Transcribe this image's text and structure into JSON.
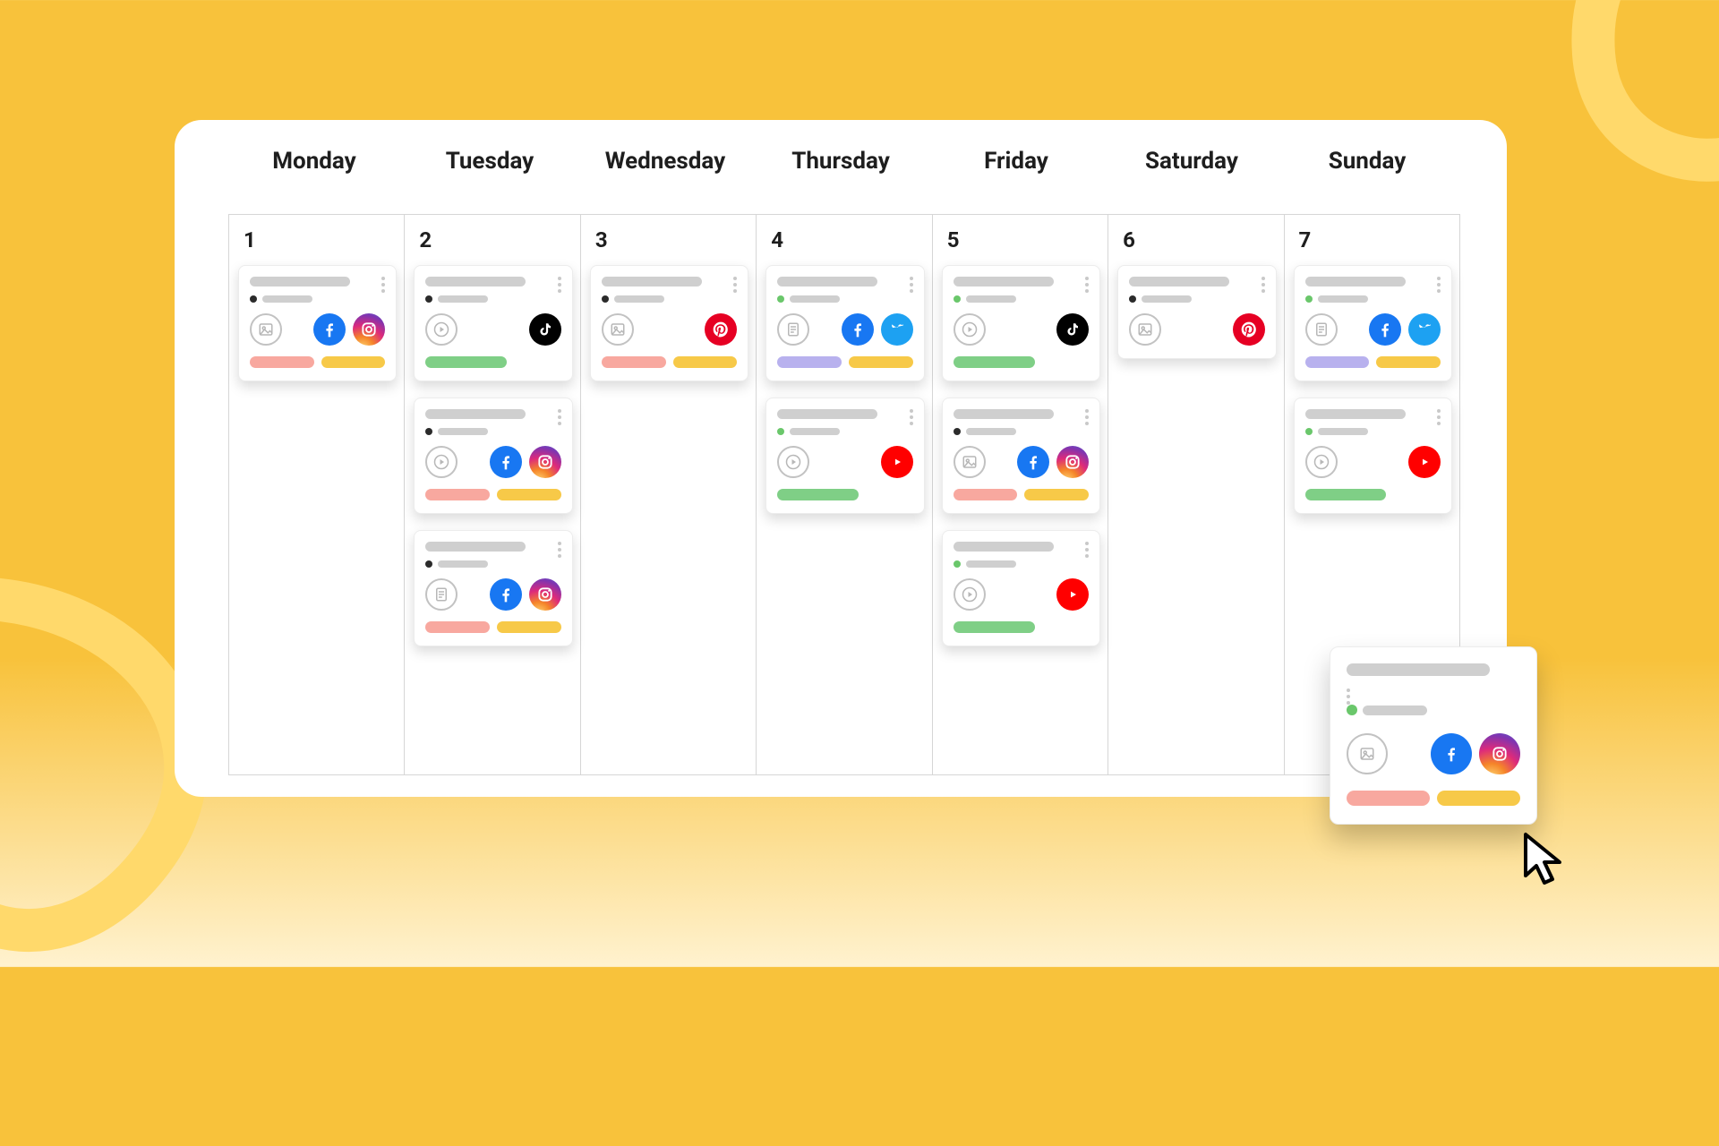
{
  "calendar": {
    "days": [
      {
        "label": "Monday",
        "date": "1",
        "cards": [
          {
            "status": "black",
            "media": "image",
            "socials": [
              "facebook",
              "instagram"
            ],
            "pills": [
              "pink",
              "yellow"
            ]
          }
        ]
      },
      {
        "label": "Tuesday",
        "date": "2",
        "cards": [
          {
            "status": "black",
            "media": "video",
            "socials": [
              "tiktok"
            ],
            "pills": [
              "green"
            ]
          },
          {
            "status": "black",
            "media": "video",
            "socials": [
              "facebook",
              "instagram"
            ],
            "pills": [
              "pink",
              "yellow"
            ]
          },
          {
            "status": "black",
            "media": "doc",
            "socials": [
              "facebook",
              "instagram"
            ],
            "pills": [
              "pink",
              "yellow"
            ]
          }
        ]
      },
      {
        "label": "Wednesday",
        "date": "3",
        "cards": [
          {
            "status": "black",
            "media": "image",
            "socials": [
              "pinterest"
            ],
            "pills": [
              "pink",
              "yellow"
            ]
          }
        ]
      },
      {
        "label": "Thursday",
        "date": "4",
        "cards": [
          {
            "status": "green",
            "media": "doc",
            "socials": [
              "facebook",
              "twitter"
            ],
            "pills": [
              "lilac",
              "yellow"
            ]
          },
          {
            "status": "green",
            "media": "video",
            "socials": [
              "youtube"
            ],
            "pills": [
              "green"
            ]
          }
        ]
      },
      {
        "label": "Friday",
        "date": "5",
        "cards": [
          {
            "status": "green",
            "media": "video",
            "socials": [
              "tiktok"
            ],
            "pills": [
              "green"
            ]
          },
          {
            "status": "black",
            "media": "image",
            "socials": [
              "facebook",
              "instagram"
            ],
            "pills": [
              "pink",
              "yellow"
            ]
          },
          {
            "status": "green",
            "media": "video",
            "socials": [
              "youtube"
            ],
            "pills": [
              "green"
            ]
          }
        ]
      },
      {
        "label": "Saturday",
        "date": "6",
        "cards": [
          {
            "status": "black",
            "media": "image",
            "socials": [
              "pinterest"
            ],
            "pills": []
          }
        ]
      },
      {
        "label": "Sunday",
        "date": "7",
        "cards": [
          {
            "status": "green",
            "media": "doc",
            "socials": [
              "facebook",
              "twitter"
            ],
            "pills": [
              "lilac",
              "yellow"
            ]
          },
          {
            "status": "green",
            "media": "video",
            "socials": [
              "youtube"
            ],
            "pills": [
              "green"
            ]
          }
        ]
      }
    ]
  },
  "floating_card": {
    "status": "green",
    "media": "image",
    "socials": [
      "facebook",
      "instagram"
    ],
    "pills": [
      "pink",
      "yellow"
    ]
  }
}
